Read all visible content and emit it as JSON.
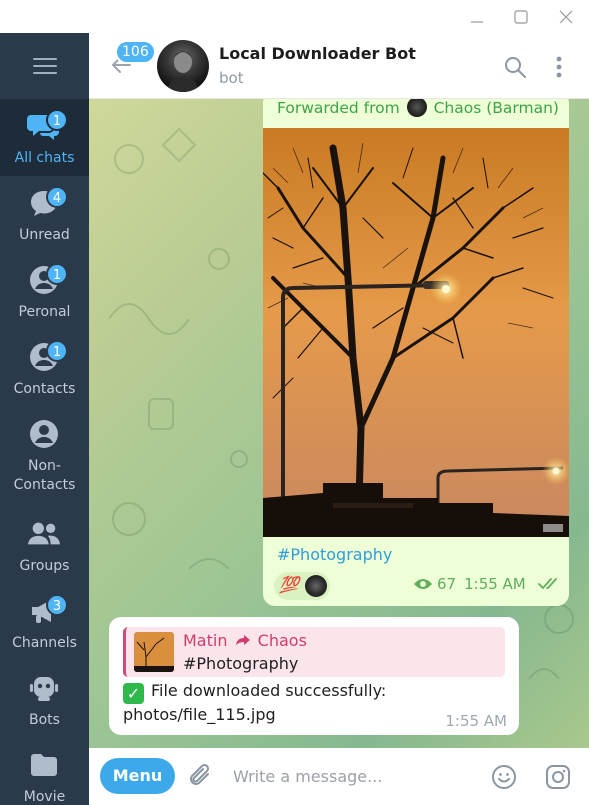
{
  "window": {
    "minimize_icon": "minimize-icon",
    "maximize_icon": "maximize-icon",
    "close_icon": "close-icon"
  },
  "sidebar": {
    "folders": [
      {
        "label": "All chats",
        "badge": "1",
        "icon": "chat-bubbles-icon",
        "active": true
      },
      {
        "label": "Unread",
        "badge": "4",
        "icon": "chat-bubble-icon"
      },
      {
        "label": "Peronal",
        "badge": "1",
        "icon": "person-icon"
      },
      {
        "label": "Contacts",
        "badge": "1",
        "icon": "person-icon"
      },
      {
        "label": "Non-\nContacts",
        "badge": "",
        "icon": "person-outline-icon"
      },
      {
        "label": "Groups",
        "badge": "",
        "icon": "group-icon"
      },
      {
        "label": "Channels",
        "badge": "3",
        "icon": "megaphone-icon"
      },
      {
        "label": "Bots",
        "badge": "",
        "icon": "robot-icon"
      },
      {
        "label": "Movie",
        "badge": "",
        "icon": "folder-icon"
      }
    ],
    "colors": {
      "bg": "#2a3a4b",
      "active_bg": "#1e2c3a",
      "accent": "#4fb4f5"
    }
  },
  "header": {
    "unread_count": "106",
    "title": "Local Downloader Bot",
    "subtitle": "bot"
  },
  "messages": {
    "forwarded": {
      "forwarded_prefix": "Forwarded from",
      "from": "Chaos (Barman)",
      "hashtag": "#Photography",
      "reaction_emoji": "💯",
      "views": "67",
      "time": "1:55 AM"
    },
    "incoming": {
      "reply_from": "Matin",
      "reply_to": "Chaos",
      "reply_text": "#Photography",
      "line1": "File downloaded successfully:",
      "line2": "photos/file_115.jpg",
      "time": "1:55 AM"
    }
  },
  "composer": {
    "menu_label": "Menu",
    "placeholder": "Write a message..."
  }
}
